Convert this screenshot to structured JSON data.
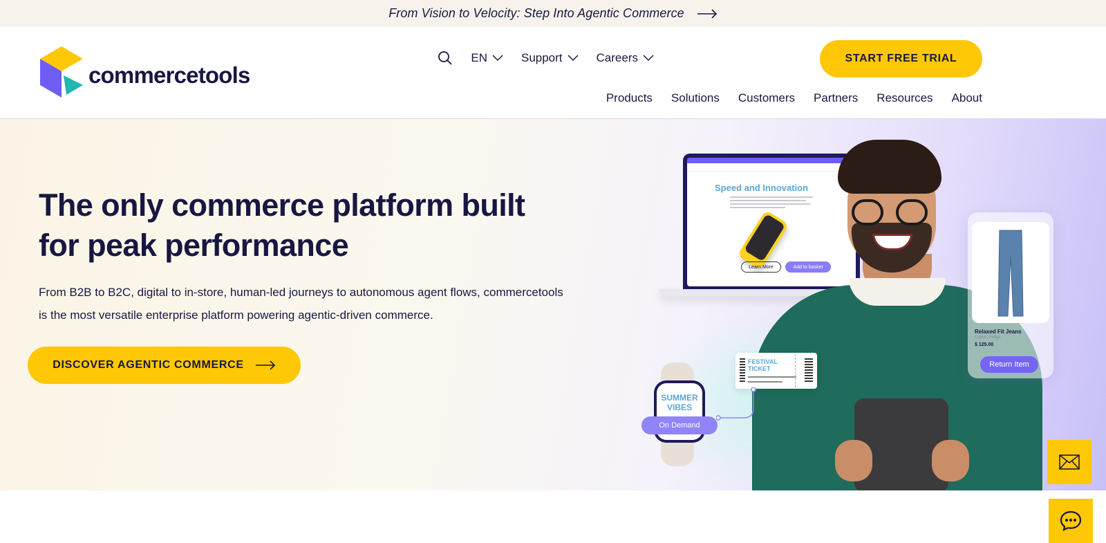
{
  "announcement": {
    "text": "From Vision to Velocity: Step Into Agentic Commerce"
  },
  "header": {
    "logo_text": "commercetools",
    "utility": {
      "language": "EN",
      "support": "Support",
      "careers": "Careers"
    },
    "cta_trial": "START FREE TRIAL",
    "nav": [
      "Products",
      "Solutions",
      "Customers",
      "Partners",
      "Resources",
      "About"
    ]
  },
  "hero": {
    "title": "The only commerce platform built for peak performance",
    "subtitle": "From B2B to B2C, digital to in-store, human-led journeys to autonomous agent flows, commercetools is the most versatile enterprise platform powering agentic-driven commerce.",
    "cta": "DISCOVER AGENTIC COMMERCE",
    "illustration": {
      "laptop_title": "Speed and Innovation",
      "laptop_btn_learn": "Learn More",
      "laptop_btn_basket": "Add to basket",
      "jeans_name": "Relaxed Fit Jeans",
      "jeans_color": "Colour: Indigo",
      "jeans_price": "$ 125.00",
      "return_button": "Return Item",
      "ticket_title": "FESTIVAL TICKET",
      "watch_text": "SUMMER VIBES",
      "on_demand": "On Demand"
    }
  },
  "colors": {
    "accent": "#ffc806",
    "navy": "#191741",
    "violet": "#7565f2",
    "teal": "#1fb7b0"
  },
  "icons": {
    "search": "search-icon",
    "mail": "mail-icon",
    "chat": "chat-icon"
  }
}
